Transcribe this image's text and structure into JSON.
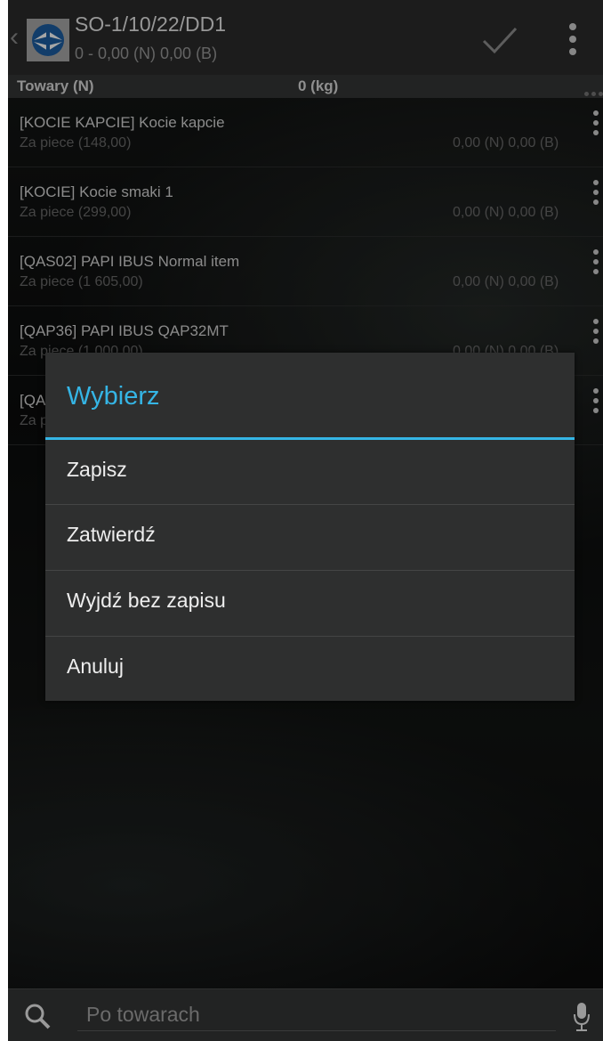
{
  "topbar": {
    "title": "SO-1/10/22/DD1",
    "subtitle": "0 - 0,00 (N) 0,00 (B)",
    "back_icon": "chevron-left-icon",
    "logo": "app-logo",
    "confirm_icon": "checkmark-icon",
    "overflow_icon": "overflow-menu-icon"
  },
  "header": {
    "goods_label": "Towary (N)",
    "weight_label": "0 (kg)"
  },
  "items": [
    {
      "name": "[KOCIE KAPCIE] Kocie kapcie",
      "sub": "Za piece (148,00)",
      "totals": "0,00 (N)  0,00 (B)"
    },
    {
      "name": "[KOCIE] Kocie smaki 1",
      "sub": "Za piece (299,00)",
      "totals": "0,00 (N)  0,00 (B)"
    },
    {
      "name": "[QAS02] PAPI IBUS Normal item",
      "sub": "Za piece (1 605,00)",
      "totals": "0,00 (N)  0,00 (B)"
    },
    {
      "name": "[QAP36] PAPI IBUS QAP32MT",
      "sub": "Za piece (1 000,00)",
      "totals": "0,00 (N)  0,00 (B)"
    },
    {
      "name": "[QA",
      "sub": "Za p",
      "totals": ""
    }
  ],
  "dialog": {
    "title": "Wybierz",
    "options": [
      "Zapisz",
      "Zatwierdź",
      "Wyjdź bez zapisu",
      "Anuluj"
    ]
  },
  "search": {
    "placeholder": "Po towarach",
    "value": "",
    "search_icon": "search-icon",
    "mic_icon": "microphone-icon"
  },
  "colors": {
    "accent": "#35b5e5",
    "background": "#0b0c0c",
    "topbar": "#2b2c2c"
  }
}
